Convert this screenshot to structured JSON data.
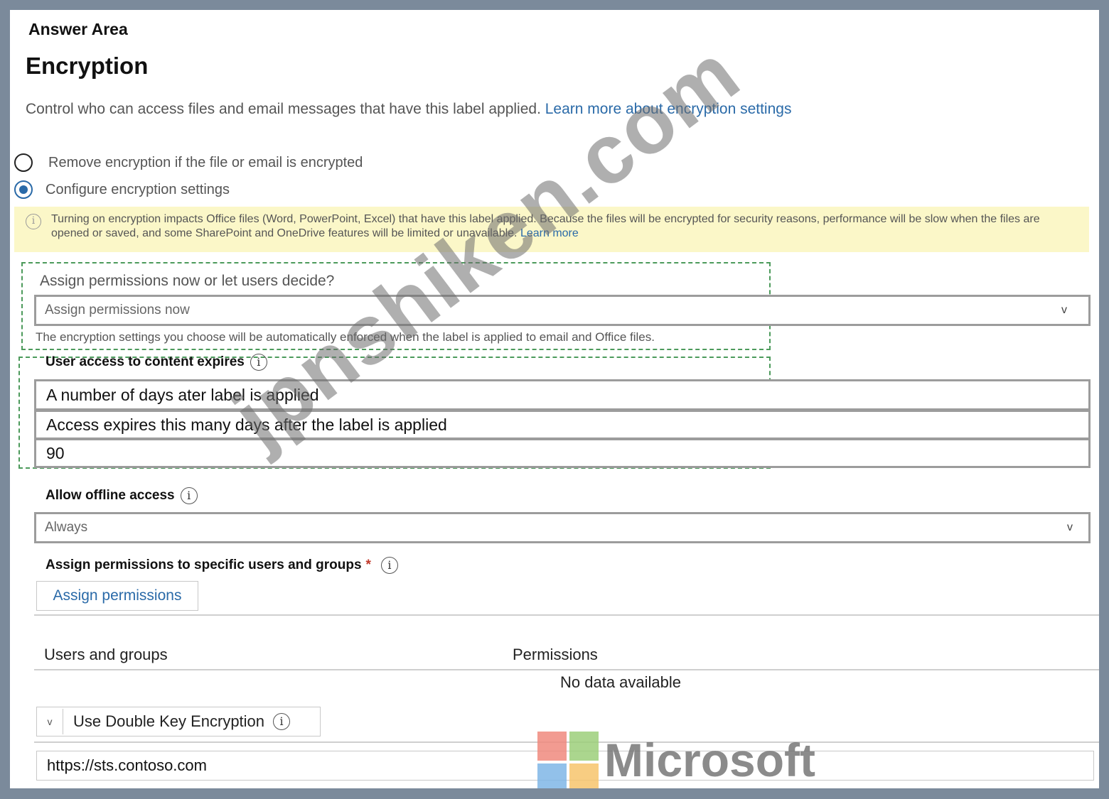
{
  "header": {
    "answer_area": "Answer Area",
    "title": "Encryption",
    "description": "Control who can access files and email messages that have this label applied.",
    "learn_more_link": "Learn more about encryption settings"
  },
  "radios": {
    "remove_label": "Remove encryption if the file or email is encrypted",
    "configure_label": "Configure encryption settings",
    "selected": "configure"
  },
  "notice": {
    "text": "Turning on encryption impacts Office files (Word, PowerPoint, Excel) that have this label applied. Because the files will be encrypted for security reasons, performance will be slow when the files are opened or saved, and some SharePoint and OneDrive features will be limited or unavailable.",
    "link": "Learn more"
  },
  "assign_mode": {
    "label": "Assign permissions now or let users decide?",
    "value": "Assign permissions now",
    "note": "The encryption settings you choose will be automatically enforced when the label is applied to email and Office files."
  },
  "user_access": {
    "label": "User access to content expires",
    "option": "A number of days ater label is applied",
    "days_label": "Access expires this many days after the label is applied",
    "days_value": "90"
  },
  "offline": {
    "label": "Allow offline access",
    "value": "Always"
  },
  "specific": {
    "label": "Assign permissions to specific users and groups",
    "required_mark": "*",
    "button": "Assign permissions"
  },
  "table": {
    "columns": [
      "Users and groups",
      "Permissions"
    ],
    "empty": "No data available"
  },
  "dke": {
    "label": "Use Double Key Encryption",
    "toggle_glyph": "v",
    "url": "https://sts.contoso.com"
  },
  "watermark": {
    "text": "jpnshiken.com",
    "brand": "Microsoft"
  },
  "icons": {
    "chevron": "v",
    "info": "i"
  },
  "colors": {
    "link": "#2a6aa8",
    "notice_bg": "#fbf7c8",
    "dashed_border": "#4c9a5b"
  }
}
